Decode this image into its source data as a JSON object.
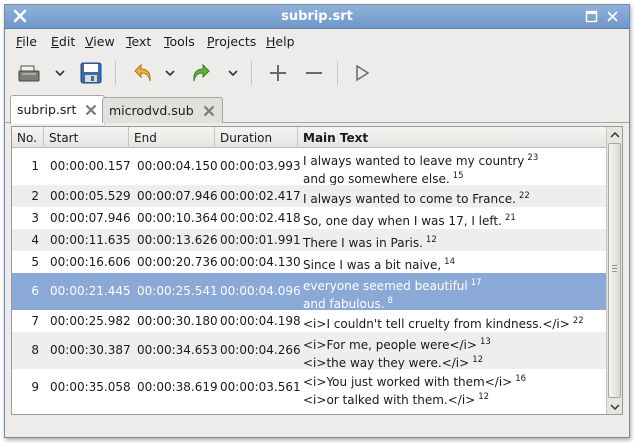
{
  "window": {
    "title": "subrip.srt"
  },
  "menu": [
    {
      "label": "File"
    },
    {
      "label": "Edit"
    },
    {
      "label": "View"
    },
    {
      "label": "Text"
    },
    {
      "label": "Tools"
    },
    {
      "label": "Projects"
    },
    {
      "label": "Help"
    }
  ],
  "toolbar": {
    "icons": [
      "open-icon",
      "dropdown-arrow-icon",
      "save-icon",
      "undo-icon",
      "dropdown-arrow-icon",
      "redo-icon",
      "dropdown-arrow-icon",
      "add-icon",
      "remove-icon",
      "play-icon"
    ]
  },
  "tabs": [
    {
      "label": "subrip.srt",
      "active": true
    },
    {
      "label": "microdvd.sub",
      "active": false
    }
  ],
  "table": {
    "columns": [
      "No.",
      "Start",
      "End",
      "Duration",
      "Main Text"
    ],
    "rows": [
      {
        "no": "1",
        "start": "00:00:00.157",
        "end": "00:00:04.150",
        "duration": "00:00:03.993",
        "lines": [
          {
            "text": "I always wanted to leave my country",
            "count": "23"
          },
          {
            "text": "and go somewhere else.",
            "count": "15"
          }
        ]
      },
      {
        "no": "2",
        "start": "00:00:05.529",
        "end": "00:00:07.946",
        "duration": "00:00:02.417",
        "lines": [
          {
            "text": "I always wanted to come to France.",
            "count": "22"
          }
        ]
      },
      {
        "no": "3",
        "start": "00:00:07.946",
        "end": "00:00:10.364",
        "duration": "00:00:02.418",
        "lines": [
          {
            "text": "So, one day when I was 17, I left.",
            "count": "21"
          }
        ]
      },
      {
        "no": "4",
        "start": "00:00:11.635",
        "end": "00:00:13.626",
        "duration": "00:00:01.991",
        "lines": [
          {
            "text": "There I was in Paris.",
            "count": "12"
          }
        ]
      },
      {
        "no": "5",
        "start": "00:00:16.606",
        "end": "00:00:20.736",
        "duration": "00:00:04.130",
        "lines": [
          {
            "text": "Since I was a bit naive,",
            "count": "14"
          }
        ]
      },
      {
        "no": "6",
        "start": "00:00:21.445",
        "end": "00:00:25.541",
        "duration": "00:00:04.096",
        "selected": true,
        "lines": [
          {
            "text": "everyone seemed beautiful",
            "count": "17"
          },
          {
            "text": "and fabulous.",
            "count": "8"
          }
        ]
      },
      {
        "no": "7",
        "start": "00:00:25.982",
        "end": "00:00:30.180",
        "duration": "00:00:04.198",
        "lines": [
          {
            "text": "<i>I couldn't tell cruelty from kindness.</i>",
            "count": "22"
          }
        ]
      },
      {
        "no": "8",
        "start": "00:00:30.387",
        "end": "00:00:34.653",
        "duration": "00:00:04.266",
        "lines": [
          {
            "text": "<i>For me, people were</i>",
            "count": "13"
          },
          {
            "text": "<i>the way they were.</i>",
            "count": "12"
          }
        ]
      },
      {
        "no": "9",
        "start": "00:00:35.058",
        "end": "00:00:38.619",
        "duration": "00:00:03.561",
        "lines": [
          {
            "text": "<i>You just worked with them</i>",
            "count": "16"
          },
          {
            "text": "<i>or talked with them.</i>",
            "count": "12"
          }
        ]
      }
    ]
  },
  "colors": {
    "selection": "#8aa9d6",
    "titlebar": "#7ea4d2"
  }
}
